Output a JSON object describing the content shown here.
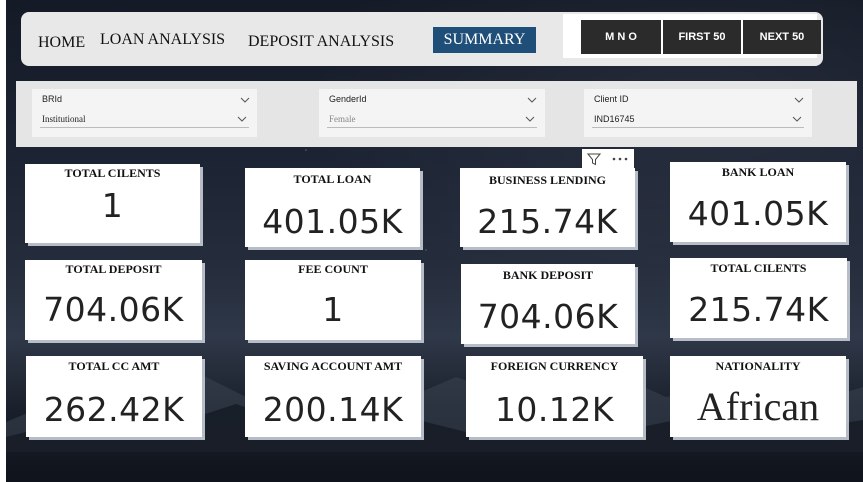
{
  "nav": {
    "home": "HOME",
    "loan_analysis": "LOAN ANALYSIS",
    "deposit_analysis": "DEPOSIT ANALYSIS",
    "summary": "SUMMARY",
    "buttons": [
      "M N O",
      "FIRST 50",
      "NEXT 50"
    ]
  },
  "filters": {
    "br_id": {
      "label": "BRId",
      "value": "Institutional"
    },
    "gender_id": {
      "label": "GenderId",
      "value": "Female"
    },
    "client_id": {
      "label": "Client ID",
      "value": "IND16745"
    }
  },
  "visual_header": {
    "icons": [
      "filter-icon",
      "more-options-icon"
    ]
  },
  "cards": [
    {
      "title": "TOTAL CILENTS",
      "value": "1"
    },
    {
      "title": "TOTAL LOAN",
      "value": "401.05K"
    },
    {
      "title": "BUSINESS LENDING",
      "value": "215.74K"
    },
    {
      "title": "BANK LOAN",
      "value": "401.05K"
    },
    {
      "title": "TOTAL DEPOSIT",
      "value": "704.06K"
    },
    {
      "title": "FEE COUNT",
      "value": "1"
    },
    {
      "title": "BANK DEPOSIT",
      "value": "704.06K"
    },
    {
      "title": "TOTAL CILENTS",
      "value": "215.74K"
    },
    {
      "title": "TOTAL CC AMT",
      "value": "262.42K"
    },
    {
      "title": "SAVING ACCOUNT AMT",
      "value": "200.14K"
    },
    {
      "title": "FOREIGN CURRENCY",
      "value": "10.12K"
    },
    {
      "title": "NATIONALITY",
      "value": "African"
    }
  ],
  "colors": {
    "summary_tab": "#1f4e79",
    "dark_button": "#2b2b2b",
    "background": "#1d2434"
  }
}
